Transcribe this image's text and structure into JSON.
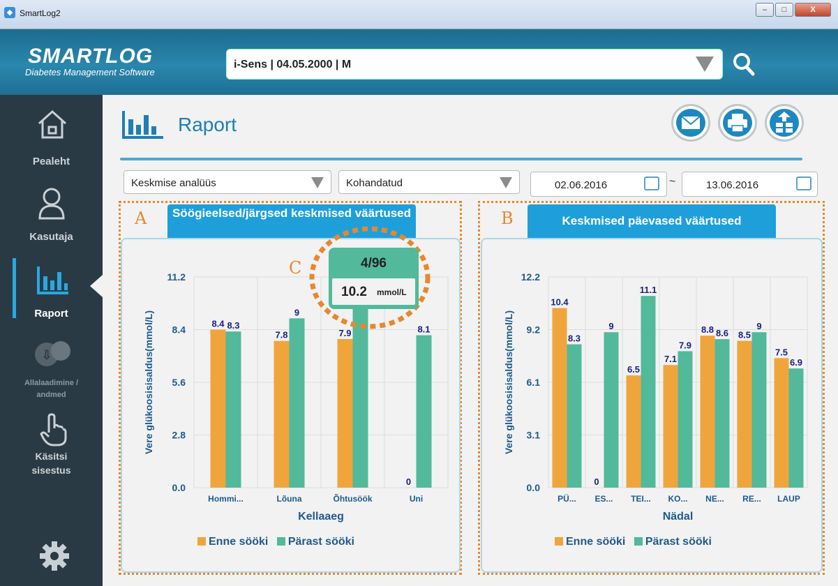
{
  "window": {
    "title": "SmartLog2",
    "minimize": "–",
    "maximize": "□",
    "close": "X"
  },
  "header": {
    "logo": "SMARTLOG",
    "logo_sub": "Diabetes Management Software",
    "patient_value": "i-Sens | 04.05.2000 | M"
  },
  "sidebar": {
    "items": [
      {
        "label": "Pealeht",
        "icon": "home-icon"
      },
      {
        "label": "Kasutaja",
        "icon": "user-icon"
      },
      {
        "label": "Raport",
        "icon": "report-chart-icon"
      },
      {
        "label": "Allalaadimine /",
        "label2": "andmed",
        "icon": "download-icon"
      },
      {
        "label": "Käsitsi",
        "label2": "sisestus",
        "icon": "hand-icon"
      }
    ],
    "settings_icon": "gear-icon"
  },
  "page": {
    "title": "Raport",
    "actions": [
      "mail-icon",
      "print-icon",
      "export-icon"
    ]
  },
  "filters": {
    "analysis": "Keskmise analüüs",
    "period": "Kohandatud",
    "date_from": "02.06.2016",
    "date_sep": "~",
    "date_to": "13.06.2016"
  },
  "annotations": {
    "a": "A",
    "b": "B",
    "c": "C"
  },
  "tooltip": {
    "count": "4/96",
    "value": "10.2",
    "unit": "mmol/L"
  },
  "colors": {
    "before": "#f0a53c",
    "after": "#52b99a",
    "accent": "#1e9fda"
  },
  "chart_data": [
    {
      "type": "bar",
      "title": "Söögieelsed/järgsed keskmised väärtused",
      "xlabel": "Kellaaeg",
      "ylabel": "Vere glükoosisisaldus(mmol/L)",
      "ylim": [
        0,
        11.2
      ],
      "yticks": [
        "0.0",
        "2.8",
        "5.6",
        "8.4",
        "11.2"
      ],
      "categories": [
        "Hommi...",
        "Lõuna",
        "Õhtusöök",
        "Uni"
      ],
      "series": [
        {
          "name": "Enne sööki",
          "values": [
            8.4,
            7.8,
            7.9,
            0
          ],
          "labels": [
            "8.4",
            "7.8",
            "7.9",
            "0"
          ]
        },
        {
          "name": "Pärast sööki",
          "values": [
            8.3,
            9,
            10.2,
            8.1
          ],
          "labels": [
            "8.3",
            "9",
            "",
            "8.1"
          ]
        }
      ],
      "legend": "bottom"
    },
    {
      "type": "bar",
      "title": "Keskmised päevased väärtused",
      "xlabel": "Nädal",
      "ylabel": "Vere glükoosisisaldus(mmol/L)",
      "ylim": [
        0,
        12.2
      ],
      "yticks": [
        "0.0",
        "3.1",
        "6.1",
        "9.2",
        "12.2"
      ],
      "categories": [
        "PÜ...",
        "ES...",
        "TEI...",
        "KO...",
        "NE...",
        "RE...",
        "LAUP"
      ],
      "series": [
        {
          "name": "Enne sööki",
          "values": [
            10.4,
            0,
            6.5,
            7.1,
            8.8,
            8.5,
            7.5
          ],
          "labels": [
            "10.4",
            "0",
            "6.5",
            "7.1",
            "8.8",
            "8.5",
            "7.5"
          ]
        },
        {
          "name": "Pärast sööki",
          "values": [
            8.3,
            9,
            11.1,
            7.9,
            8.6,
            9,
            6.9
          ],
          "labels": [
            "8.3",
            "9",
            "11.1",
            "7.9",
            "8.6",
            "9",
            "6.9"
          ]
        }
      ],
      "legend": "bottom"
    }
  ]
}
